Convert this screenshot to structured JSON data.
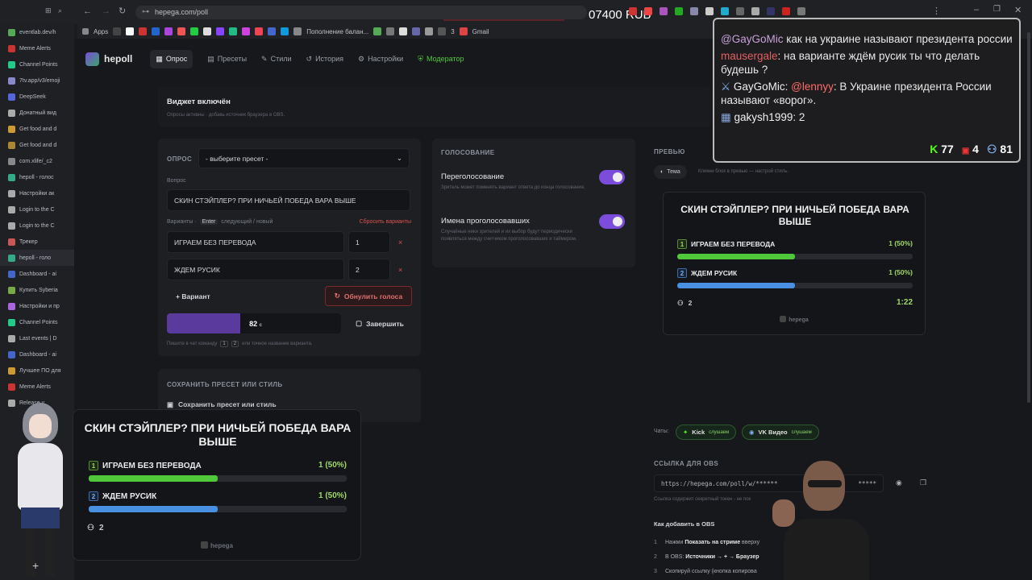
{
  "browser": {
    "url": "hepega.com/poll",
    "balance": "07400 RUB",
    "bookmarks": [
      "Apps",
      "Пополнение балан...",
      "3",
      "Gmail"
    ]
  },
  "sidebar": {
    "items": [
      "eventlab.dev/h",
      "Meme Alerts",
      "Channel Points",
      "7tv.app/v3/emoji",
      "DeepSeek",
      "Донатный вид",
      "Get food and d",
      "Get food and d",
      "com.xlife/_c2",
      "hepoll - голос",
      "Настройки ак",
      "Login to the C",
      "Login to the C",
      "Трекер",
      "hepoll - голо",
      "Dashboard - ai",
      "Купить Syberia",
      "Настройки и пр",
      "Channel Points",
      "Last events | D",
      "Dashboard - ai",
      "Лучшее ПО для",
      "Meme Alerts",
      "Release v"
    ]
  },
  "app": {
    "logo": "hepoll",
    "nav": [
      "Опрос",
      "Пресеты",
      "Стили",
      "История",
      "Настройки",
      "Модератор"
    ],
    "widget_title": "Виджет включён",
    "widget_sub": "Опросы активны · добавь источник браузера в OBS.",
    "poll": {
      "label": "ОПРОС",
      "preset_placeholder": "- выберите пресет -",
      "question_label": "Вопрос",
      "question": "СКИН СТЭЙПЛЕР? ПРИ НИЧЬЕЙ ПОБЕДА ВАРА ВЫШЕ",
      "variants_label": "Варианты ·",
      "enter_key": "Enter",
      "variants_hint": "следующий / новый",
      "reset_variants": "Сбросить варианты",
      "options": [
        {
          "text": "ИГРАЕМ БЕЗ ПЕРЕВОДА",
          "num": "1"
        },
        {
          "text": "ЖДЕМ РУСИК",
          "num": "2"
        }
      ],
      "add_variant": "+ Вариант",
      "reset_votes": "Обнулить голоса",
      "timer": "82",
      "timer_unit": "с",
      "timer_progress": 0.42,
      "finish": "Завершить",
      "chat_hint_a": "Пишите в чат команду",
      "chat_hint_b": "или точное название варианта.",
      "cmd1": "1",
      "cmd2": "2"
    },
    "preset": {
      "title": "СОХРАНИТЬ ПРЕСЕТ ИЛИ СТИЛЬ",
      "button": "Сохранить пресет или стиль"
    },
    "voting": {
      "title": "ГОЛОСОВАНИЕ",
      "revote": "Переголосование",
      "revote_desc": "Зритель может поменять вариант ответа до конца голосования.",
      "names": "Имена проголосовавших",
      "names_desc": "Случайные ники зрителей и их выбор будут периодически появляться между счетчиком проголосовавших и таймером."
    },
    "preview": {
      "title": "ПРЕВЬЮ",
      "theme": "Тема",
      "hint": "Кликни блок в превью — настрой стиль.",
      "question": "СКИН СТЭЙПЛЕР? ПРИ НИЧЬЕЙ ПОБЕДА ВАРА ВЫШЕ",
      "options": [
        {
          "n": "1",
          "text": "ИГРАЕМ БЕЗ ПЕРЕВОДА",
          "votes": "1 (50%)",
          "share": 0.5
        },
        {
          "n": "2",
          "text": "ЖДЕМ РУСИК",
          "votes": "1 (50%)",
          "share": 0.5
        }
      ],
      "voters": "2",
      "time": "1:22",
      "brand": "hepega"
    },
    "chats": {
      "label": "Чаты:",
      "kick": "Kick",
      "vk": "VK Видео",
      "status": "слушаем"
    },
    "obs": {
      "title": "ССЫЛКА ДЛЯ OBS",
      "url": "https://hepega.com/poll/w/******",
      "url_end": "*****",
      "hint": "Ссылка содержит секретный токен - не пок",
      "how": "Как добавить в OBS",
      "steps": [
        {
          "n": "1",
          "pre": "Нажми ",
          "bold": "Показать на стриме",
          "post": " вверху"
        },
        {
          "n": "2",
          "pre": "В OBS: ",
          "bold": "Источники → + → Браузер",
          "post": ""
        },
        {
          "n": "3",
          "pre": "Скопируй ссылку (кнопка копирова",
          "bold": "",
          "post": ""
        }
      ]
    }
  },
  "chat": {
    "lines": [
      {
        "user": "@GayGoMic",
        "text": " как на украине называют президента россии"
      },
      {
        "user": "mausergale",
        "text": ": на варианте ждём русик ты что делать будешь ?"
      },
      {
        "user": "GayGoMic",
        "text": ": "
      },
      {
        "mention": "@lennyy",
        "text": ": В Украине президента России называют «ворог»."
      },
      {
        "user": "gakysh1999",
        "text": ": 2"
      }
    ],
    "kick": "77",
    "vk": "4",
    "viewers": "81"
  },
  "overlay": {
    "question": "СКИН СТЭЙПЛЕР? ПРИ НИЧЬЕЙ ПОБЕДА ВАРА ВЫШЕ",
    "options": [
      {
        "n": "1",
        "text": "ИГРАЕМ БЕЗ ПЕРЕВОДА",
        "votes": "1 (50%)",
        "share": 0.5
      },
      {
        "n": "2",
        "text": "ЖДЕМ РУСИК",
        "votes": "1 (50%)",
        "share": 0.5
      }
    ],
    "voters": "2",
    "brand": "hepega"
  },
  "colors": {
    "accent": "#7c4ddb",
    "green": "#4fc93a",
    "blue": "#4a90e2",
    "kick": "#53fc18"
  }
}
